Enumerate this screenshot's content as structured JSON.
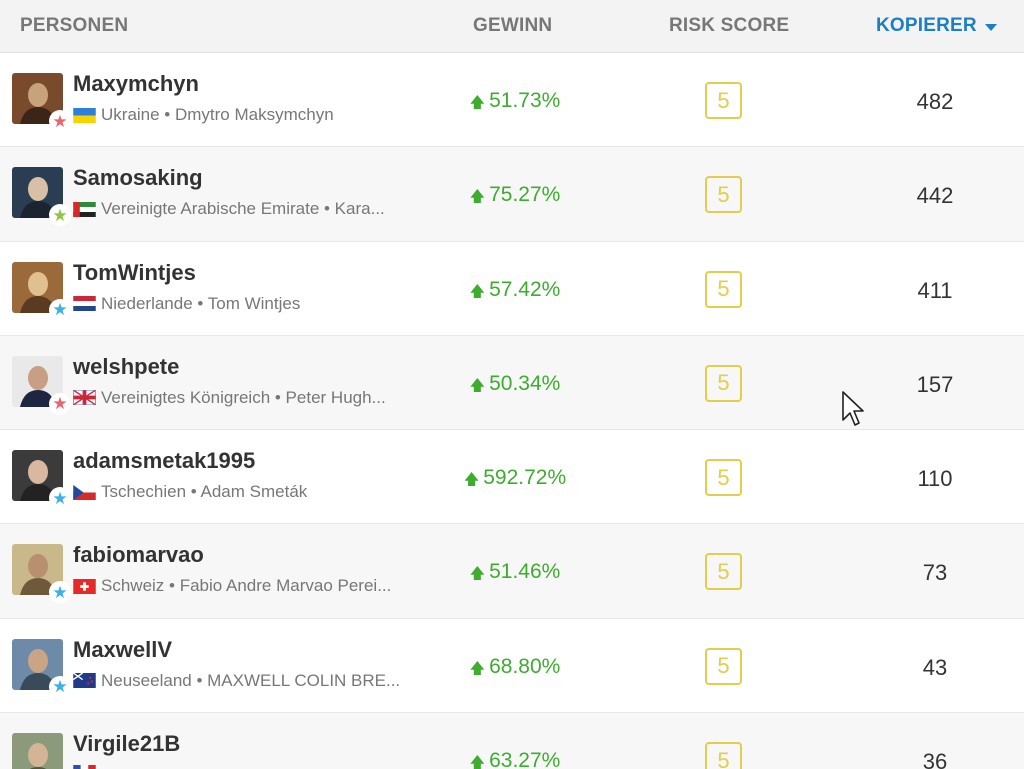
{
  "header": {
    "people": "PERSONEN",
    "gain": "GEWINN",
    "risk": "RISK SCORE",
    "copiers": "KOPIERER"
  },
  "colors": {
    "accent": "#1c7fc6",
    "gain": "#3eac2f",
    "risk": "#e2cd4c",
    "star_red": "#e8666b",
    "star_green": "#8dc63f",
    "star_blue": "#3ab0e6"
  },
  "rows": [
    {
      "username": "Maxymchyn",
      "subtitle": "Ukraine • Dmytro Maksymchyn",
      "flag": "ukraine-flag",
      "star": "red-star-icon",
      "gain": "51.73%",
      "risk": "5",
      "copiers": "482"
    },
    {
      "username": "Samosaking",
      "subtitle": "Vereinigte Arabische Emirate • Kara...",
      "flag": "uae-flag",
      "star": "green-star-icon",
      "gain": "75.27%",
      "risk": "5",
      "copiers": "442"
    },
    {
      "username": "TomWintjes",
      "subtitle": "Niederlande • Tom Wintjes",
      "flag": "netherlands-flag",
      "star": "blue-star-icon",
      "gain": "57.42%",
      "risk": "5",
      "copiers": "411"
    },
    {
      "username": "welshpete",
      "subtitle": "Vereinigtes Königreich • Peter Hugh...",
      "flag": "uk-flag",
      "star": "red-star-icon",
      "gain": "50.34%",
      "risk": "5",
      "copiers": "157"
    },
    {
      "username": "adamsmetak1995",
      "subtitle": "Tschechien • Adam Smeták",
      "flag": "czech-flag",
      "star": "blue-star-icon",
      "gain": "592.72%",
      "risk": "5",
      "copiers": "110"
    },
    {
      "username": "fabiomarvao",
      "subtitle": "Schweiz • Fabio Andre Marvao Perei...",
      "flag": "switzerland-flag",
      "star": "blue-star-icon",
      "gain": "51.46%",
      "risk": "5",
      "copiers": "73"
    },
    {
      "username": "MaxwellV",
      "subtitle": "Neuseeland • MAXWELL COLIN BRE...",
      "flag": "new-zealand-flag",
      "star": "blue-star-icon",
      "gain": "68.80%",
      "risk": "5",
      "copiers": "43"
    },
    {
      "username": "Virgile21B",
      "subtitle": "",
      "flag": "france-flag",
      "star": "",
      "gain": "63.27%",
      "risk": "5",
      "copiers": "36"
    }
  ],
  "ui": {
    "gain_arrow": "🡅",
    "star_glyph": "★"
  }
}
